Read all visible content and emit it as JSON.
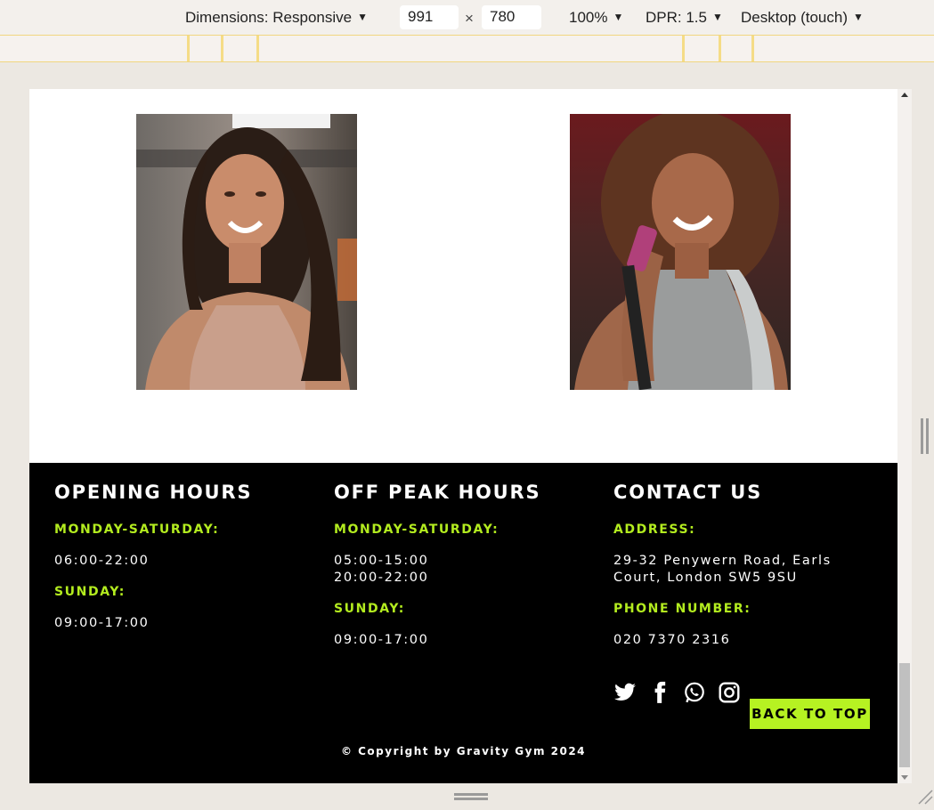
{
  "devtools": {
    "dimensions_label": "Dimensions: Responsive",
    "width": "991",
    "height": "780",
    "times": "×",
    "zoom": "100%",
    "dpr": "DPR: 1.5",
    "device_mode": "Desktop (touch)"
  },
  "team_photos": [
    {
      "icon": "trainer-photo-1"
    },
    {
      "icon": "trainer-photo-2"
    }
  ],
  "footer": {
    "opening": {
      "title": "OPENING HOURS",
      "weekday_label": "MONDAY-SATURDAY:",
      "weekday_hours": "06:00-22:00",
      "sunday_label": "SUNDAY:",
      "sunday_hours": "09:00-17:00"
    },
    "offpeak": {
      "title": "OFF PEAK HOURS",
      "weekday_label": "MONDAY-SATURDAY:",
      "weekday_hours_1": "05:00-15:00",
      "weekday_hours_2": "20:00-22:00",
      "sunday_label": "SUNDAY:",
      "sunday_hours": "09:00-17:00"
    },
    "contact": {
      "title": "CONTACT US",
      "address_label": "ADDRESS:",
      "address_1": "29-32 Penywern Road, Earls",
      "address_2": "Court, London SW5 9SU",
      "phone_label": "PHONE NUMBER:",
      "phone": "020 7370 2316"
    },
    "social": [
      "twitter-icon",
      "facebook-icon",
      "whatsapp-icon",
      "instagram-icon"
    ],
    "back_to_top": "BACK TO TOP",
    "copyright": "© Copyright by Gravity Gym 2024"
  },
  "colors": {
    "accent": "#b3ec1f",
    "footer_bg": "#000000",
    "text": "#ffffff"
  }
}
